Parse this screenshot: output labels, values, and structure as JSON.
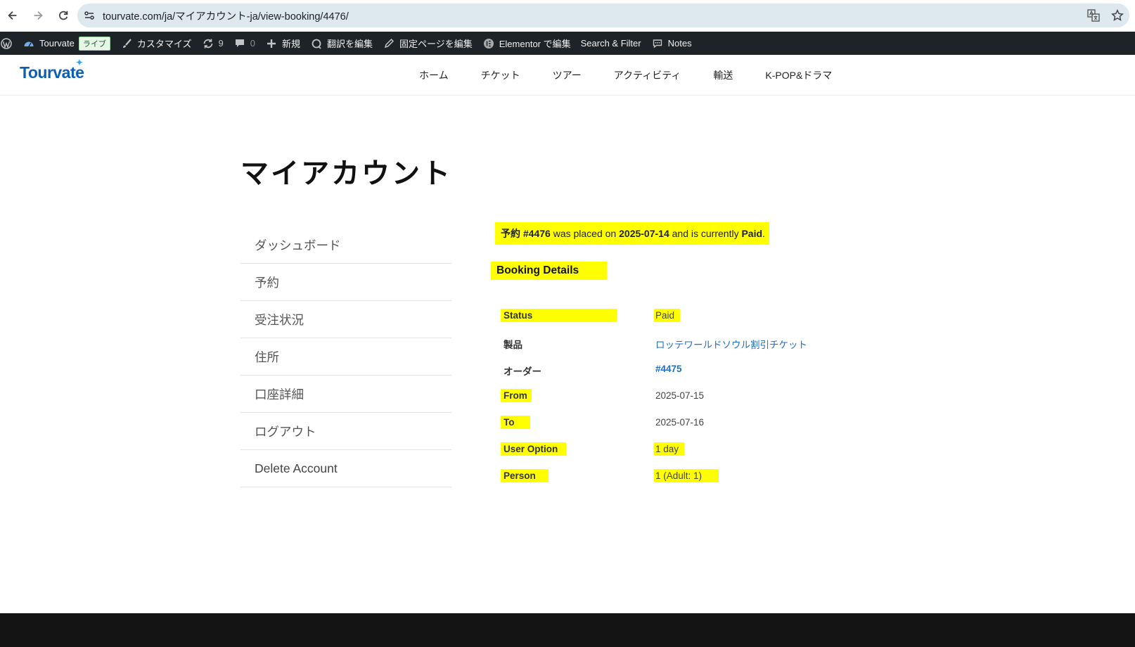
{
  "browser": {
    "url": "tourvate.com/ja/マイアカウント-ja/view-booking/4476/",
    "icons": [
      "back-arrow-icon",
      "forward-arrow-icon",
      "reload-icon",
      "site-info-icon",
      "translate-icon",
      "bookmark-star-icon"
    ]
  },
  "admin_bar": {
    "site_name": "Tourvate",
    "live_badge": "ライブ",
    "customize": "カスタマイズ",
    "updates_count": "9",
    "comments_count": "0",
    "new": "新規",
    "edit_translation": "翻訳を編集",
    "edit_page": "固定ページを編集",
    "elementor_edit": "Elementor で編集",
    "search_filter": "Search & Filter",
    "notes": "Notes"
  },
  "header": {
    "logo": "Tourvate",
    "nav": [
      "ホーム",
      "チケット",
      "ツアー",
      "アクティビティ",
      "輸送",
      "K-POP&ドラマ"
    ]
  },
  "page": {
    "title": "マイアカウント"
  },
  "account_nav": [
    "ダッシュボード",
    "予約",
    "受注状況",
    "住所",
    "口座詳細",
    "ログアウト",
    "Delete Account"
  ],
  "notice": {
    "prefix": "予約 ",
    "booking_id": "#4476",
    "mid1": " was placed on ",
    "date": "2025-07-14",
    "mid2": " and is currently ",
    "status": "Paid",
    "suffix": "."
  },
  "booking_details": {
    "heading": "Booking Details",
    "rows": [
      {
        "label": "Status",
        "value": "Paid"
      },
      {
        "label": "製品",
        "value": "ロッテワールドソウル割引チケット"
      },
      {
        "label": "オーダー",
        "value": "#4475"
      },
      {
        "label": "From",
        "value": "2025-07-15"
      },
      {
        "label": "To",
        "value": "2025-07-16"
      },
      {
        "label": "User Option",
        "value": "1 day"
      },
      {
        "label": "Person",
        "value": "1 (Adult: 1)"
      }
    ]
  },
  "colors": {
    "highlight": "#ffff00",
    "link": "#1f6fc9",
    "admin_bar": "#1d2327",
    "footer": "#141414"
  }
}
